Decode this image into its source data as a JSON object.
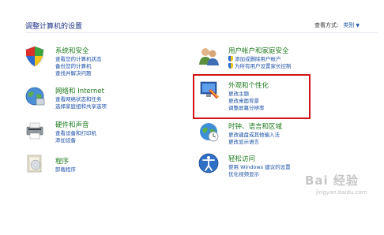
{
  "header": {
    "title": "调整计算机的设置",
    "view_by_label": "查看方式:",
    "view_by_value": "类别"
  },
  "left_column": [
    {
      "name": "system",
      "icon": "system-security-icon",
      "title": "系统和安全",
      "links": [
        "查看您的计算机状态",
        "备份您的计算机",
        "查找并解决问题"
      ]
    },
    {
      "name": "network",
      "icon": "network-internet-icon",
      "title": "网络和 Internet",
      "links": [
        "查看网络状态和任务",
        "选择家庭组和共享选项"
      ]
    },
    {
      "name": "hardware",
      "icon": "hardware-sound-icon",
      "title": "硬件和声音",
      "links": [
        "查看设备和打印机",
        "添加设备"
      ]
    },
    {
      "name": "programs",
      "icon": "programs-icon",
      "title": "程序",
      "links": [
        "卸载程序"
      ]
    }
  ],
  "right_column": [
    {
      "name": "user-accounts",
      "icon": "user-accounts-icon",
      "title": "用户帐户和家庭安全",
      "links": [
        "添加或删除用户帐户",
        "为所有用户设置家长控制"
      ]
    },
    {
      "name": "appearance",
      "icon": "appearance-personalization-icon",
      "title": "外观和个性化",
      "links": [
        "更改主题",
        "更改桌面背景",
        "调整屏幕分辨率"
      ]
    },
    {
      "name": "clock",
      "icon": "clock-language-region-icon",
      "title": "时钟、语言和区域",
      "links": [
        "更改键盘或其他输入法",
        "更改显示语言"
      ]
    },
    {
      "name": "ease",
      "icon": "ease-of-access-icon",
      "title": "轻松访问",
      "links": [
        "使用 Windows 建议的设置",
        "优化视频显示"
      ]
    }
  ],
  "watermark": {
    "logo": "Bai 经验",
    "url": "jingyan.baidu.com"
  },
  "colors": {
    "category_title": "#1e7a1e",
    "link": "#1a50a8",
    "highlight": "#d3121a"
  }
}
